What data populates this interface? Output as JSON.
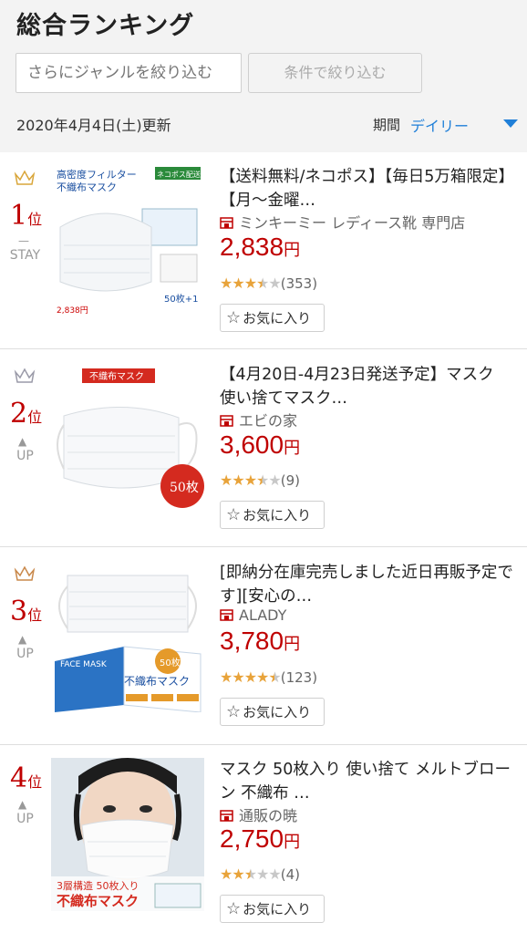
{
  "header": {
    "title": "総合ランキング",
    "genre_placeholder": "さらにジャンルを絞り込む",
    "condition_button": "条件で絞り込む",
    "updated": "2020年4月4日(土)更新",
    "period_label": "期間",
    "period_value": "デイリー"
  },
  "items": [
    {
      "rank": "1",
      "rank_suffix": "位",
      "trend": "STAY",
      "trend_mark": "—",
      "crown_color": "#d9a63a",
      "title": "【送料無料/ネコポス】【毎日5万箱限定】【月～金曜…",
      "shop": "ミンキーミー レディース靴 専門店",
      "price": "2,838",
      "yen": "円",
      "rating_value": 3.5,
      "review_count": "(353)",
      "fav_label": "お気に入り",
      "image_text": [
        "高密度フィルター",
        "不織布マスク",
        "ネコポス配送",
        "50枚+1",
        "2,838円"
      ]
    },
    {
      "rank": "2",
      "rank_suffix": "位",
      "trend": "UP",
      "trend_mark": "▲",
      "crown_color": "#9a9aa8",
      "title": "【4月20日-4月23日発送予定】マスク 使い捨てマスク…",
      "shop": "エビの家",
      "price": "3,600",
      "yen": "円",
      "rating_value": 3.5,
      "review_count": "(9)",
      "fav_label": "お気に入り",
      "image_text": [
        "不織布マスク",
        "50枚"
      ]
    },
    {
      "rank": "3",
      "rank_suffix": "位",
      "trend": "UP",
      "trend_mark": "▲",
      "crown_color": "#c9884a",
      "title": "[即納分在庫完売しました近日再販予定です][安心の…",
      "shop": "ALADY",
      "price": "3,780",
      "yen": "円",
      "rating_value": 4.5,
      "review_count": "(123)",
      "fav_label": "お気に入り",
      "image_text": [
        "不織布マスク",
        "50枚",
        "FACE MASK"
      ]
    },
    {
      "rank": "4",
      "rank_suffix": "位",
      "trend": "UP",
      "trend_mark": "▲",
      "crown_color": "#ffffff",
      "title": "マスク 50枚入り 使い捨て メルトブローン 不織布 …",
      "shop": "通販の暁",
      "price": "2,750",
      "yen": "円",
      "rating_value": 2.5,
      "review_count": "(4)",
      "fav_label": "お気に入り",
      "image_text": [
        "3層構造 50枚入り",
        "不織布マスク"
      ]
    }
  ],
  "colors": {
    "price_red": "#bf0000",
    "link_blue": "#1f7fd8",
    "star_gold": "#e8a33a"
  },
  "icons": [
    "crown-icon",
    "shop-icon",
    "star-outline-icon",
    "chevron-down-icon"
  ]
}
